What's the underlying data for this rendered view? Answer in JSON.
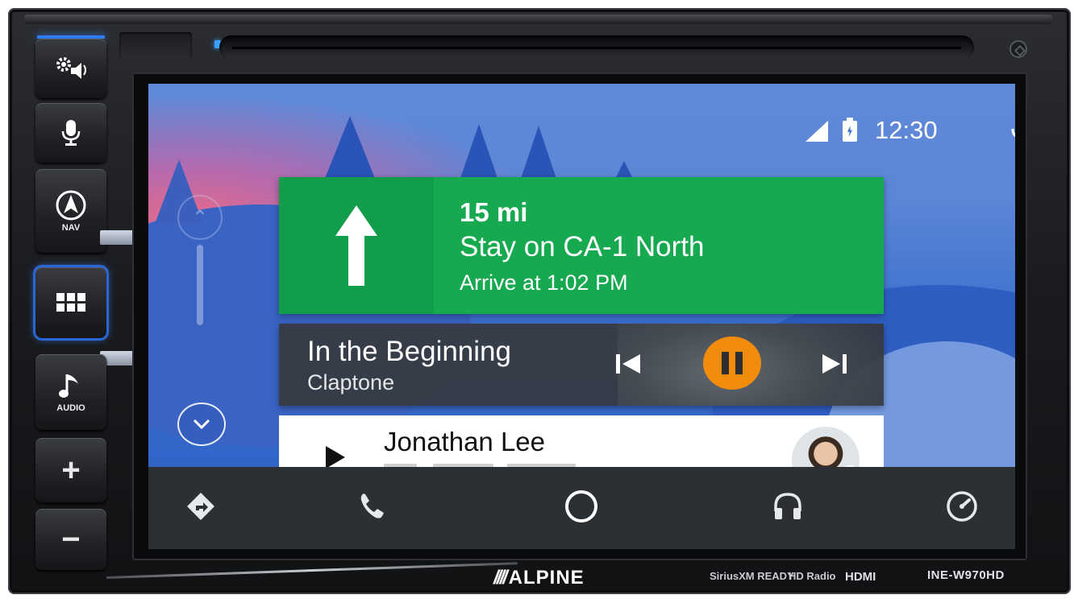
{
  "device": {
    "brand": "ALPINE",
    "model": "INE-W970HD",
    "badges": [
      "SiriusXM READY",
      "HD Radio",
      "HDMI"
    ],
    "hard_buttons": [
      {
        "id": "settings-audio",
        "icon": "gear-speaker-icon",
        "label": ""
      },
      {
        "id": "voice",
        "icon": "microphone-icon",
        "label": ""
      },
      {
        "id": "nav",
        "icon": "navigation-arrow-icon",
        "label": "NAV"
      },
      {
        "id": "apps",
        "icon": "app-grid-icon",
        "label": ""
      },
      {
        "id": "audio",
        "icon": "music-note-icon",
        "label": "AUDIO"
      },
      {
        "id": "volume-up",
        "icon": "plus-icon",
        "label": "+"
      },
      {
        "id": "volume-down",
        "icon": "minus-icon",
        "label": "−"
      }
    ]
  },
  "status_bar": {
    "time": "12:30",
    "signal_icon": "cell-signal-icon",
    "battery_icon": "battery-charging-icon",
    "mic_icon": "microphone-icon"
  },
  "navigation": {
    "distance": "15 mi",
    "instruction": "Stay on CA-1 North",
    "eta": "Arrive at 1:02 PM",
    "direction_icon": "arrow-up-icon",
    "card_color": "#16a94f"
  },
  "media": {
    "title": "In the Beginning",
    "artist": "Claptone",
    "controls": [
      "skip-previous-icon",
      "pause-icon",
      "skip-next-icon"
    ],
    "accent_color": "#f18c0c"
  },
  "message": {
    "contact": "Jonathan Lee",
    "play_icon": "play-icon"
  },
  "bottom_nav": [
    {
      "name": "navigation",
      "icon": "directions-icon"
    },
    {
      "name": "phone",
      "icon": "phone-icon"
    },
    {
      "name": "home",
      "icon": "home-circle-icon"
    },
    {
      "name": "music",
      "icon": "headphones-icon"
    },
    {
      "name": "exit",
      "icon": "exit-gauge-icon"
    }
  ]
}
